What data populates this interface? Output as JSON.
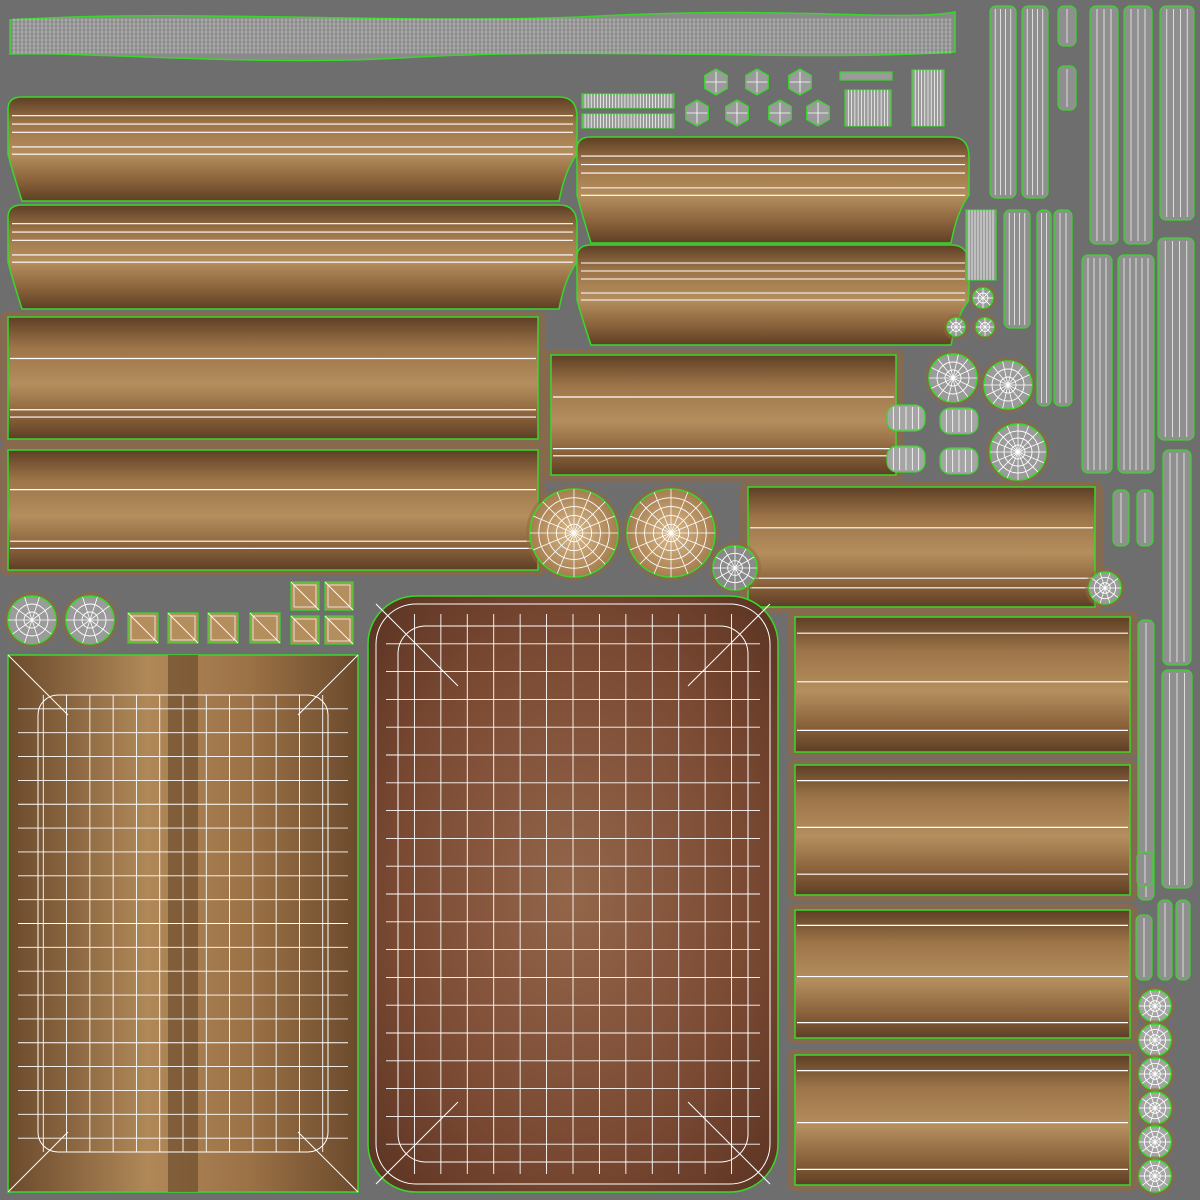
{
  "atlas": {
    "colors": {
      "background": "#6e6e6e",
      "wood_light": "#b58e5e",
      "wood_mid": "#93673d",
      "wood_dark": "#5e3f25",
      "wood_red": "#7b4a33",
      "wire": "#ffffff",
      "outline": "#38d82a"
    },
    "icons": {
      "grid": "uv-grid-icon",
      "radial": "uv-radial-icon"
    }
  }
}
